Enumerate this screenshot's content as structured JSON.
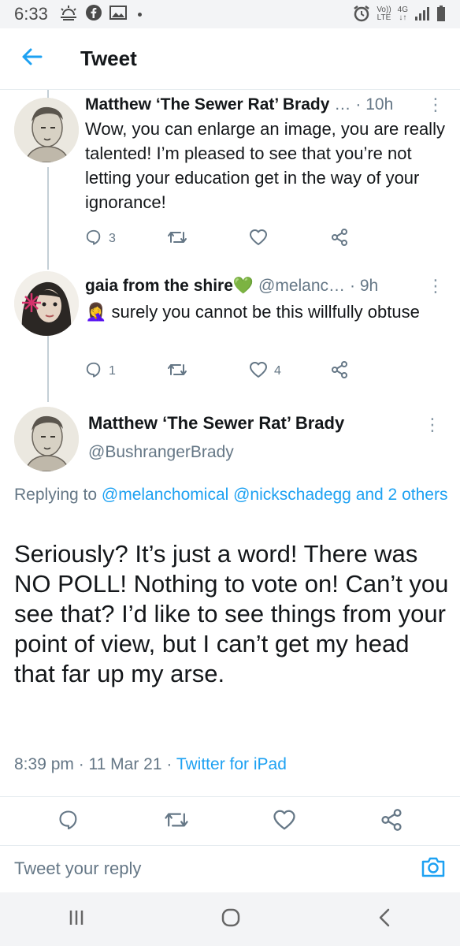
{
  "status_bar": {
    "time": "6:33",
    "network_top": "Vo))",
    "network_bottom": "LTE",
    "net_type_top": "4G",
    "net_type_bottom": "↓↑"
  },
  "app_bar": {
    "title": "Tweet"
  },
  "thread": [
    {
      "name": "Matthew ‘The Sewer Rat’ Brady",
      "handle": "…",
      "time": "· 10h",
      "text": "Wow, you can enlarge an image, you are really talented! I’m pleased to see that you’re not letting your education get in the way of your ignorance!",
      "replies": "3",
      "retweets": "",
      "likes": ""
    },
    {
      "name": "gaia from the shire💚",
      "handle": "@melanc…",
      "time": "· 9h",
      "text": "🤦‍♀️ surely you cannot be this willfully obtuse",
      "replies": "1",
      "retweets": "",
      "likes": "4"
    }
  ],
  "main_tweet": {
    "name": "Matthew ‘The Sewer Rat’ Brady",
    "handle": "@BushrangerBrady",
    "replying_prefix": "Replying to",
    "replying_to": "@melanchomical @nickschadegg and 2 others",
    "text": "Seriously? It’s just a word! There was NO POLL! Nothing to vote on! Can’t you see that? I’d like to see things from your point of view, but I can’t get my head that far up my arse.",
    "timestamp": "8:39 pm · 11 Mar 21 ·",
    "source": "Twitter for iPad"
  },
  "reply_bar": {
    "placeholder": "Tweet your reply"
  },
  "colors": {
    "accent": "#1da1f2",
    "secondary_text": "#657786",
    "primary_text": "#14171a",
    "heart_green": "#2ecc40"
  }
}
